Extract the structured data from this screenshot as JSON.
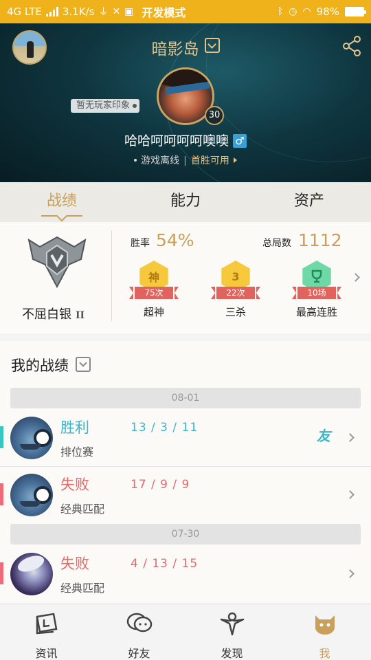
{
  "status_bar": {
    "network": "4G LTE",
    "speed": "3.1K/s",
    "mode": "开发模式",
    "battery": "98%"
  },
  "profile": {
    "server": "暗影岛",
    "impression": "暂无玩家印象",
    "level": "30",
    "nickname": "哈哈呵呵呵呵噢噢",
    "gender_symbol": "♂",
    "status": "游戏离线",
    "first_win": "首胜可用"
  },
  "tabs": [
    {
      "label": "战绩",
      "active": true
    },
    {
      "label": "能力",
      "active": false
    },
    {
      "label": "资产",
      "active": false
    }
  ],
  "rank": {
    "name": "不屈白银",
    "tier": "II",
    "win_rate_label": "胜率",
    "win_rate": "54%",
    "total_label": "总局数",
    "total": "1112",
    "medals": [
      {
        "icon": "神",
        "count": "75次",
        "name": "超神"
      },
      {
        "icon": "3",
        "count": "22次",
        "name": "三杀"
      },
      {
        "icon": "trophy-icon",
        "count": "10场",
        "name": "最高连胜"
      }
    ]
  },
  "records": {
    "title": "我的战绩",
    "groups": [
      {
        "date": "08-01",
        "matches": [
          {
            "result": "胜利",
            "mode": "排位赛",
            "kda": "13 / 3 / 11",
            "friend": "友",
            "outcome": "win"
          },
          {
            "result": "失败",
            "mode": "经典匹配",
            "kda": "17 / 9 / 9",
            "friend": "",
            "outcome": "loss"
          }
        ]
      },
      {
        "date": "07-30",
        "matches": [
          {
            "result": "失败",
            "mode": "经典匹配",
            "kda": "4 / 13 / 15",
            "friend": "",
            "outcome": "loss"
          }
        ]
      }
    ]
  },
  "bottom_nav": [
    {
      "label": "资讯",
      "icon": "news-icon",
      "active": false
    },
    {
      "label": "好友",
      "icon": "friends-icon",
      "active": false
    },
    {
      "label": "发现",
      "icon": "discover-icon",
      "active": false
    },
    {
      "label": "我",
      "icon": "me-icon",
      "active": true
    }
  ],
  "colors": {
    "status_bar": "#f0b21a",
    "accent_gold": "#c8a05c",
    "win": "#39b6c8",
    "loss": "#e5686b"
  }
}
